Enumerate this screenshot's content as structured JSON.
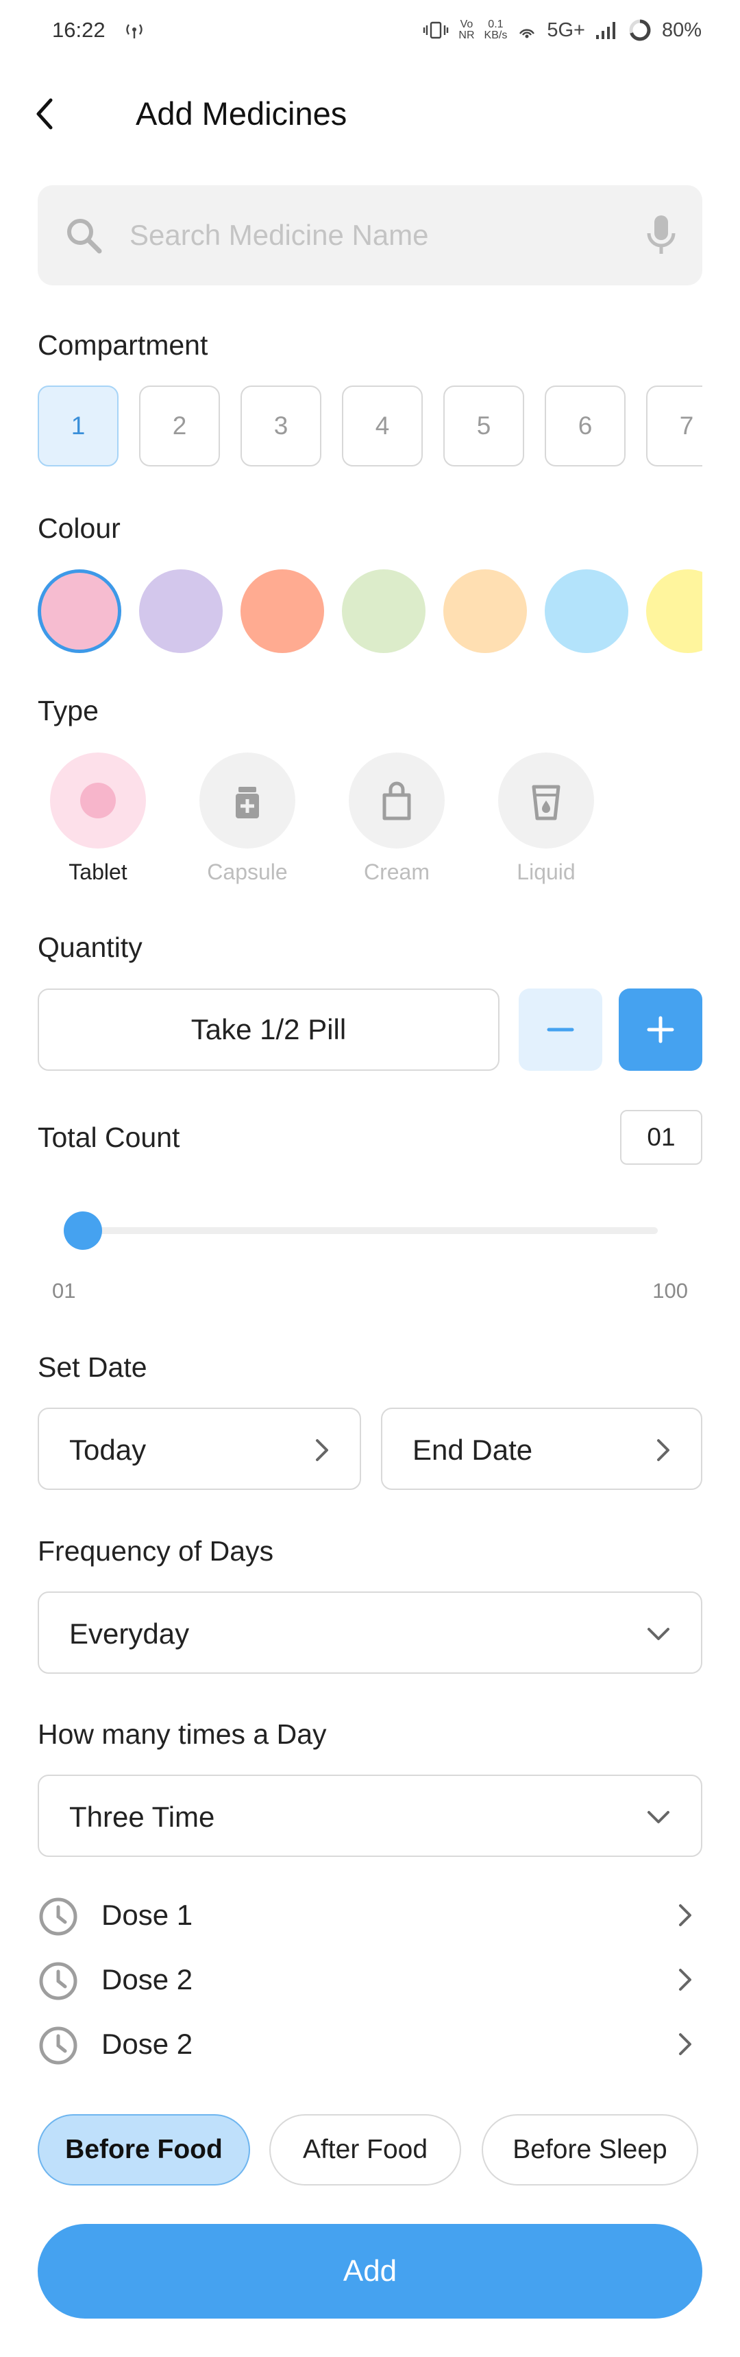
{
  "status_bar": {
    "time": "16:22",
    "volte_top": "Vo",
    "volte_bottom": "NR",
    "speed_value": "0.1",
    "speed_unit": "KB/s",
    "network": "5G+",
    "battery": "80%"
  },
  "header": {
    "title": "Add Medicines"
  },
  "search": {
    "placeholder": "Search Medicine Name",
    "value": ""
  },
  "compartment": {
    "label": "Compartment",
    "items": [
      "1",
      "2",
      "3",
      "4",
      "5",
      "6",
      "7"
    ],
    "selected": "1"
  },
  "colour": {
    "label": "Colour",
    "swatches": [
      "#f6bcd0",
      "#d3c7ec",
      "#ffab91",
      "#dcecca",
      "#ffdfb2",
      "#b3e3fb",
      "#fff59d"
    ],
    "selected_index": 0,
    "accent": "#3d99e8"
  },
  "type": {
    "label": "Type",
    "items": [
      {
        "label": "Tablet",
        "icon": "tablet-icon"
      },
      {
        "label": "Capsule",
        "icon": "capsule-icon"
      },
      {
        "label": "Cream",
        "icon": "cream-icon"
      },
      {
        "label": "Liquid",
        "icon": "liquid-icon"
      }
    ],
    "selected": "Tablet"
  },
  "quantity": {
    "label": "Quantity",
    "value": "Take 1/2 Pill",
    "minus_icon": "minus-icon",
    "plus_icon": "plus-icon"
  },
  "total_count": {
    "label": "Total Count",
    "value": "01",
    "slider_min": "01",
    "slider_max": "100",
    "slider_value": 1
  },
  "set_date": {
    "label": "Set Date",
    "start": "Today",
    "end": "End Date"
  },
  "frequency": {
    "label": "Frequency of Days",
    "value": "Everyday"
  },
  "times_a_day": {
    "label": "How many times a Day",
    "value": "Three Time"
  },
  "doses": [
    "Dose 1",
    "Dose 2",
    "Dose 2"
  ],
  "food_timing": {
    "options": [
      "Before Food",
      "After Food",
      "Before Sleep"
    ],
    "selected": "Before Food"
  },
  "add_button": {
    "label": "Add",
    "color": "#45a2f0"
  }
}
